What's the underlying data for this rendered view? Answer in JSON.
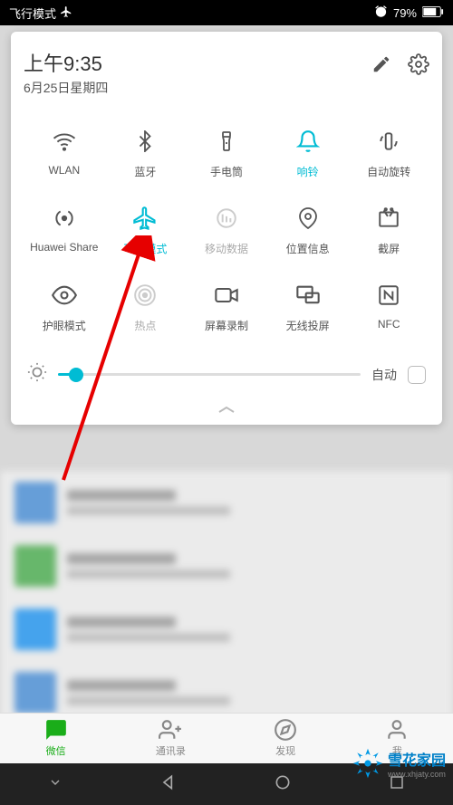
{
  "status_bar": {
    "mode_text": "飞行模式",
    "battery": "79%"
  },
  "panel": {
    "time": "上午9:35",
    "date": "6月25日星期四"
  },
  "toggles": {
    "row1": [
      {
        "label": "WLAN",
        "icon": "wifi",
        "state": "off"
      },
      {
        "label": "蓝牙",
        "icon": "bluetooth",
        "state": "off"
      },
      {
        "label": "手电筒",
        "icon": "flashlight",
        "state": "off"
      },
      {
        "label": "响铃",
        "icon": "bell",
        "state": "active"
      },
      {
        "label": "自动旋转",
        "icon": "rotate",
        "state": "off"
      }
    ],
    "row2": [
      {
        "label": "Huawei Share",
        "icon": "share",
        "state": "off"
      },
      {
        "label": "飞行模式",
        "icon": "airplane",
        "state": "active"
      },
      {
        "label": "移动数据",
        "icon": "data",
        "state": "disabled"
      },
      {
        "label": "位置信息",
        "icon": "location",
        "state": "off"
      },
      {
        "label": "截屏",
        "icon": "screenshot",
        "state": "off"
      }
    ],
    "row3": [
      {
        "label": "护眼模式",
        "icon": "eye",
        "state": "off"
      },
      {
        "label": "热点",
        "icon": "hotspot",
        "state": "disabled"
      },
      {
        "label": "屏幕录制",
        "icon": "record",
        "state": "off"
      },
      {
        "label": "无线投屏",
        "icon": "cast",
        "state": "off"
      },
      {
        "label": "NFC",
        "icon": "nfc",
        "state": "off"
      }
    ]
  },
  "brightness": {
    "auto_label": "自动",
    "value_percent": 6
  },
  "tabs": [
    {
      "label": "微信",
      "icon": "chat",
      "active": true
    },
    {
      "label": "通讯录",
      "icon": "contacts",
      "active": false
    },
    {
      "label": "发现",
      "icon": "discover",
      "active": false
    },
    {
      "label": "我",
      "icon": "me",
      "active": false
    }
  ],
  "watermark": {
    "brand": "雪花家园",
    "url": "www.xhjaty.com"
  }
}
